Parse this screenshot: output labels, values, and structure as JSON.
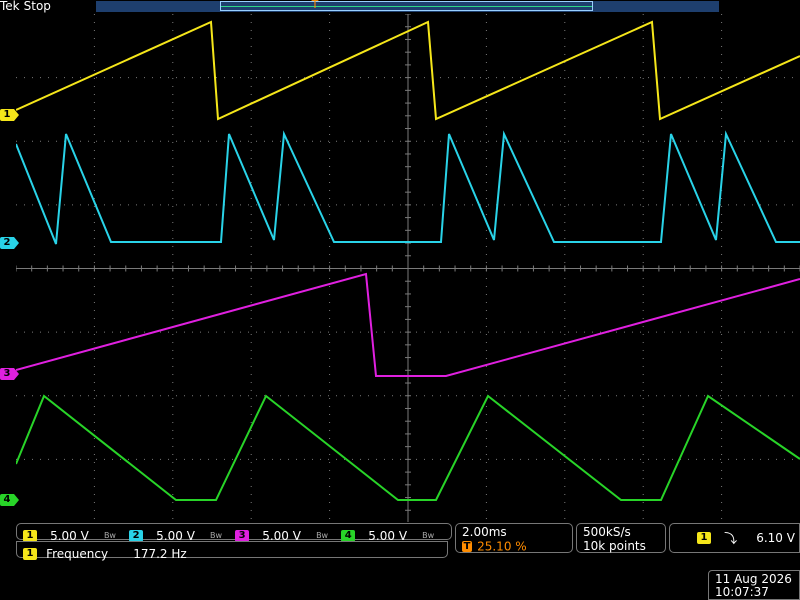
{
  "header": {
    "brand": "Tek",
    "acquisition_state": "Stop",
    "trigger_marker": "T"
  },
  "channels": [
    {
      "id": "1",
      "color": "#f5e61a",
      "scale": "5.00 V"
    },
    {
      "id": "2",
      "color": "#29d3e8",
      "scale": "5.00 V"
    },
    {
      "id": "3",
      "color": "#e020e0",
      "scale": "5.00 V"
    },
    {
      "id": "4",
      "color": "#28d428",
      "scale": "5.00 V"
    }
  ],
  "bandwidth_icon": "Bw",
  "measurement": {
    "channel": "1",
    "label": "Frequency",
    "value": "177.2 Hz"
  },
  "horizontal": {
    "time_per_div": "2.00ms",
    "trigger_position_marker": "T",
    "trigger_position": "25.10 %"
  },
  "acquisition": {
    "sample_rate": "500kS/s",
    "record_length": "10k points"
  },
  "trigger": {
    "source": "1",
    "slope_icon": "falling-edge-icon",
    "slope_glyph": "⤵",
    "level": "6.10 V"
  },
  "datetime": {
    "date": "11 Aug 2026",
    "time": "10:07:37"
  },
  "colors": {
    "graticule": "#7a7a7a",
    "accent": "#ff8c00"
  },
  "chart_data": {
    "type": "line",
    "xlabel": "",
    "ylabel": "",
    "divisions": {
      "horizontal": 10,
      "vertical": 8
    },
    "series": [
      {
        "channel": "1",
        "shape": "sawtooth (rising ramp, sharp fall)"
      },
      {
        "channel": "2",
        "shape": "double triangle pulses with flat baseline"
      },
      {
        "channel": "3",
        "shape": "slow rising ramp with single fall"
      },
      {
        "channel": "4",
        "shape": "triangle wave with flat baseline"
      }
    ]
  }
}
